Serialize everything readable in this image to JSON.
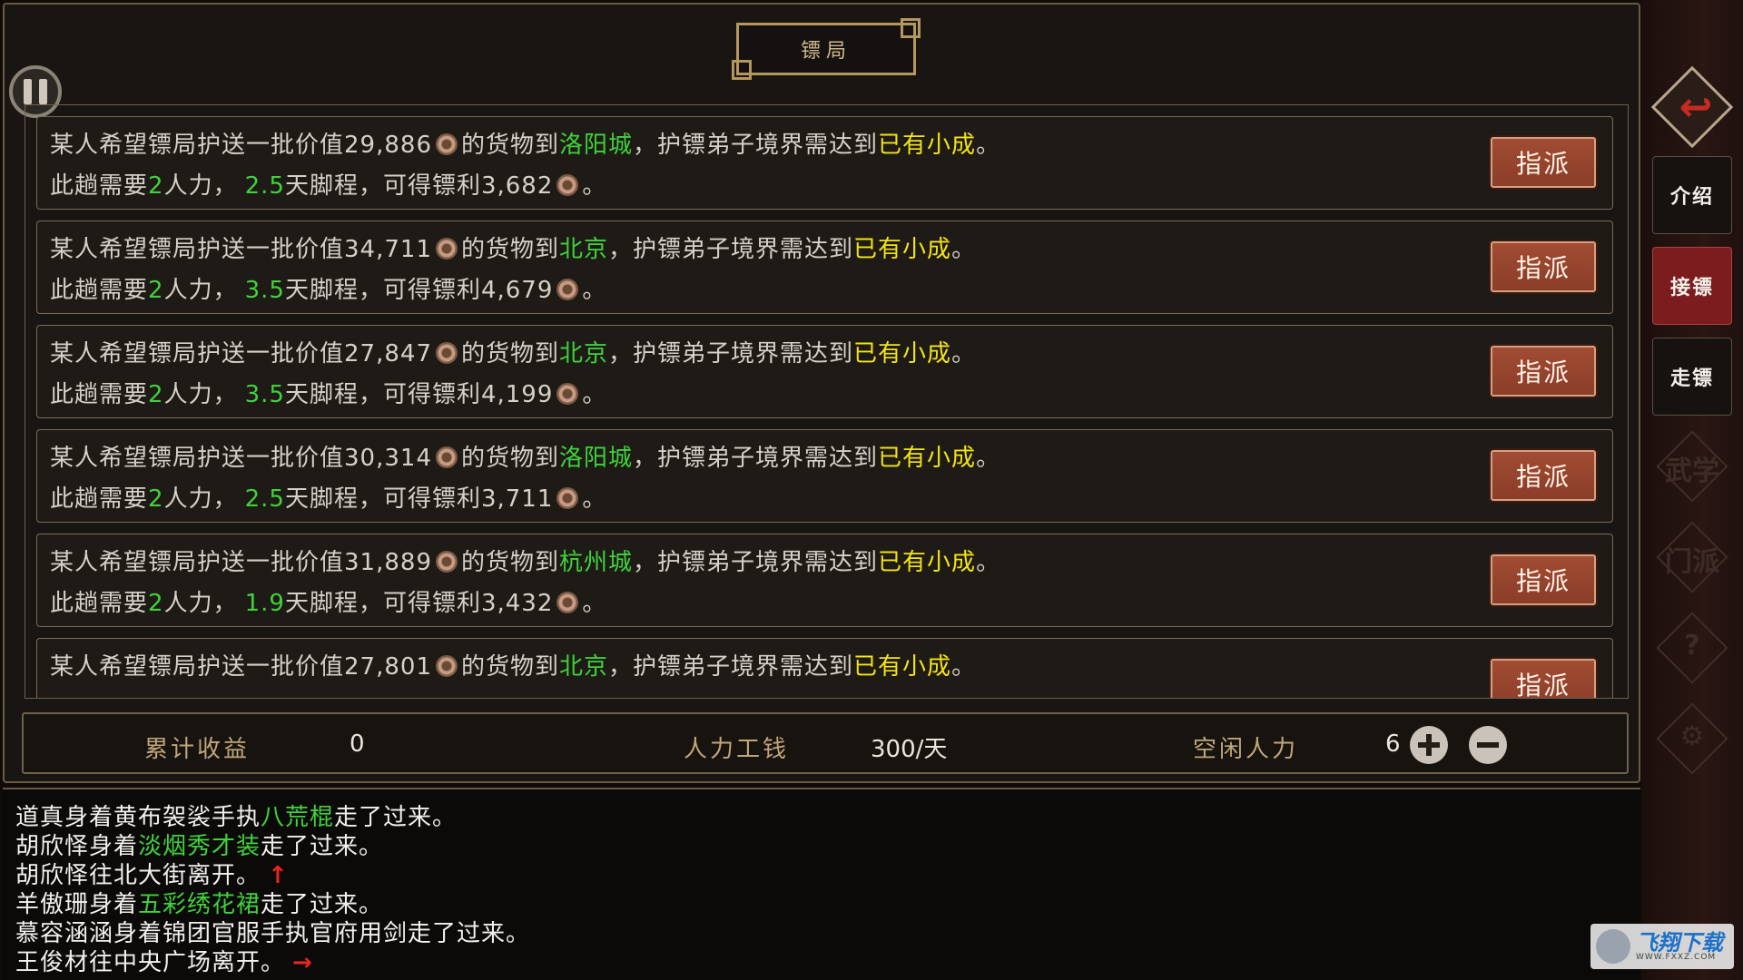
{
  "title": "镖局",
  "cargo_text": {
    "l1_a": "某人希望镖局护送一批价值",
    "l1_b": "的货物到",
    "l1_c": "，护镖弟子境界需达到",
    "l1_d": "。",
    "l2_a": "此趟需要",
    "l2_b": "人力，",
    "l2_c": "天脚程，可得镖利",
    "l2_d": "。",
    "assign_label": "指派"
  },
  "cargo_items": [
    {
      "value": "29,886",
      "destination": "洛阳城",
      "realm": "已有小成",
      "manpower": "2",
      "days": "2.5",
      "profit": "3,682"
    },
    {
      "value": "34,711",
      "destination": "北京",
      "realm": "已有小成",
      "manpower": "2",
      "days": "3.5",
      "profit": "4,679"
    },
    {
      "value": "27,847",
      "destination": "北京",
      "realm": "已有小成",
      "manpower": "2",
      "days": "3.5",
      "profit": "4,199"
    },
    {
      "value": "30,314",
      "destination": "洛阳城",
      "realm": "已有小成",
      "manpower": "2",
      "days": "2.5",
      "profit": "3,711"
    },
    {
      "value": "31,889",
      "destination": "杭州城",
      "realm": "已有小成",
      "manpower": "2",
      "days": "1.9",
      "profit": "3,432"
    },
    {
      "value": "27,801",
      "destination": "北京",
      "realm": "已有小成"
    }
  ],
  "stats": {
    "total_income_label": "累计收益",
    "total_income_value": "0",
    "wage_label": "人力工钱",
    "wage_value": "300/天",
    "idle_label": "空闲人力",
    "idle_value": "6"
  },
  "log": [
    {
      "before": "道真身着黄布袈裟手执",
      "highlight": "八荒棍",
      "after": "走了过来。",
      "arrow": ""
    },
    {
      "before": "胡欣怿身着",
      "highlight": "淡烟秀才装",
      "after": "走了过来。",
      "arrow": ""
    },
    {
      "before": "胡欣怿往北大街离开。",
      "highlight": "",
      "after": "",
      "arrow": "↑"
    },
    {
      "before": "羊傲珊身着",
      "highlight": "五彩绣花裙",
      "after": "走了过来。",
      "arrow": ""
    },
    {
      "before": "慕容涵涵身着锦团官服手执官府用剑走了过来。",
      "highlight": "",
      "after": "",
      "arrow": ""
    },
    {
      "before": "王俊材往中央广场离开。",
      "highlight": "",
      "after": "",
      "arrow": "→"
    }
  ],
  "sidebar": {
    "back_icon": "↩",
    "tabs": [
      {
        "label": "介绍",
        "active": false
      },
      {
        "label": "接镖",
        "active": true
      },
      {
        "label": "走镖",
        "active": false
      }
    ],
    "dim_items": [
      {
        "label": "武学"
      },
      {
        "label": "门派"
      },
      {
        "label": "?"
      },
      {
        "label": "⚙"
      }
    ]
  },
  "watermark": {
    "name": "飞翔下载",
    "url": "WWW.FXXZ.COM"
  },
  "colors": {
    "highlight_green": "#3fd23b",
    "highlight_yellow": "#f2e414",
    "assign_button": "#9a452e",
    "active_tab": "#7b1c1e"
  }
}
